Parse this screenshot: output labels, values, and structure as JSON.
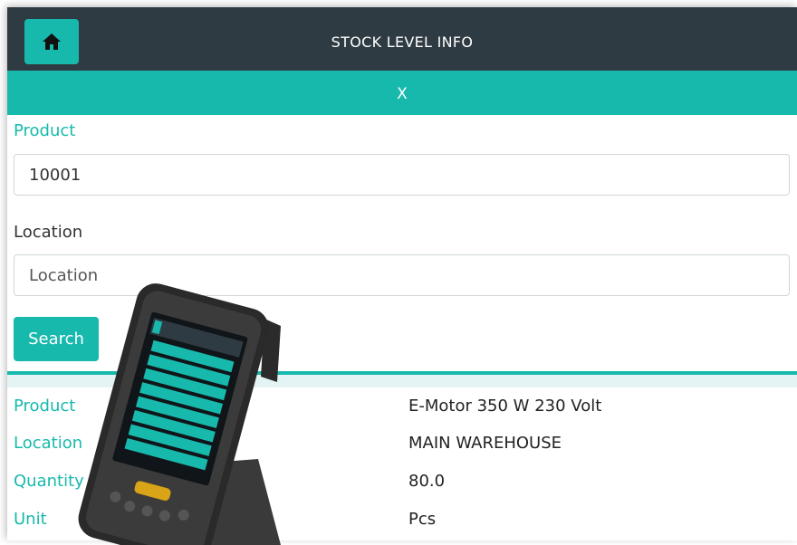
{
  "header": {
    "title": "STOCK LEVEL INFO",
    "home_icon": "home-icon"
  },
  "close_bar": {
    "label": "X"
  },
  "form": {
    "product_label": "Product",
    "product_value": "10001",
    "location_label": "Location",
    "location_value": "",
    "location_placeholder": "Location",
    "search_label": "Search"
  },
  "results": [
    {
      "label": "Product",
      "value": "E-Motor 350 W 230 Volt"
    },
    {
      "label": "Location",
      "value": "MAIN WAREHOUSE"
    },
    {
      "label": "Quantity",
      "value": "80.0"
    },
    {
      "label": "Unit",
      "value": "Pcs"
    }
  ],
  "colors": {
    "accent": "#18b9ad",
    "header_bg": "#2f3b42"
  }
}
